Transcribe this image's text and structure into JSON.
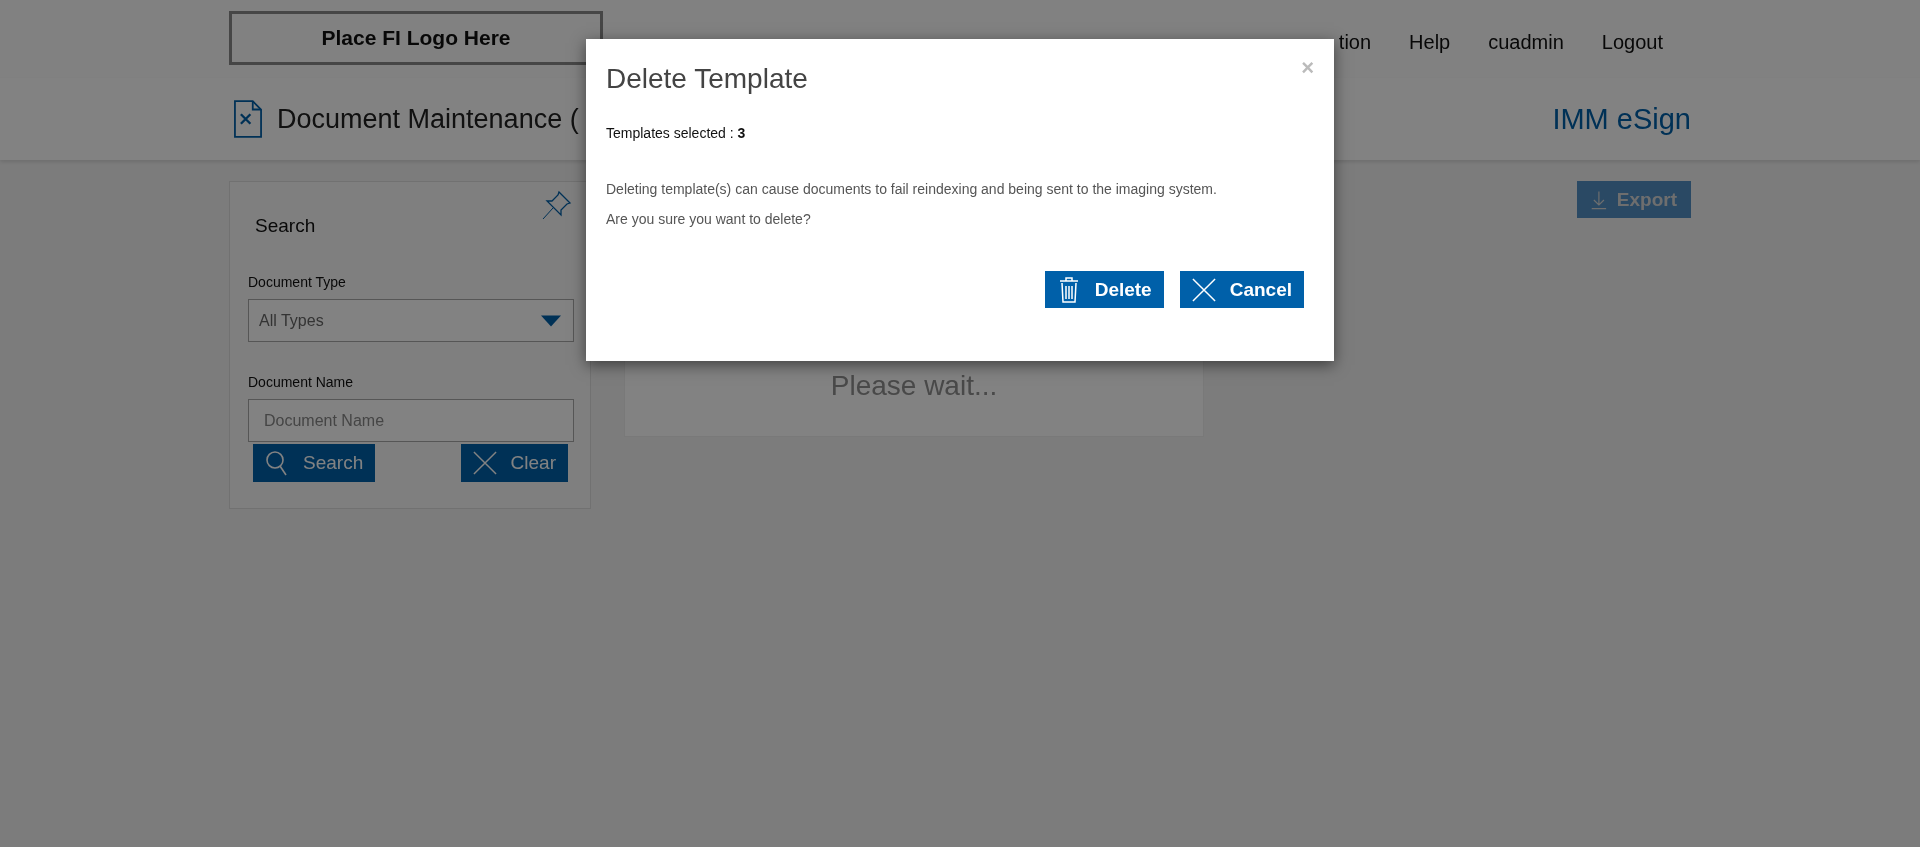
{
  "header": {
    "logo": "Place FI Logo Here",
    "nav": [
      "tion",
      "Help",
      "cuadmin",
      "Logout"
    ]
  },
  "page": {
    "title": "Document Maintenance (",
    "brand": "IMM eSign"
  },
  "search_panel": {
    "title": "Search",
    "fields": [
      {
        "label": "Document Type",
        "kind": "select",
        "value": "All Types"
      },
      {
        "label": "Document Name",
        "kind": "text",
        "placeholder": "Document Name"
      }
    ],
    "buttons": [
      {
        "label": "Search",
        "kind": "search"
      },
      {
        "label": "Clear",
        "kind": "clear"
      }
    ]
  },
  "export_button": "Export",
  "loading": "Please wait...",
  "modal": {
    "title": "Delete Template",
    "close": "×",
    "selected": "Templates selected : **3**",
    "message": [
      "Deleting template(s) can cause documents to fail reindexing and being sent to the imaging system.",
      "Are you sure you want to delete?"
    ],
    "buttons": [
      {
        "label": "Delete",
        "kind": "delete"
      },
      {
        "label": "Cancel",
        "kind": "cancel"
      }
    ]
  }
}
